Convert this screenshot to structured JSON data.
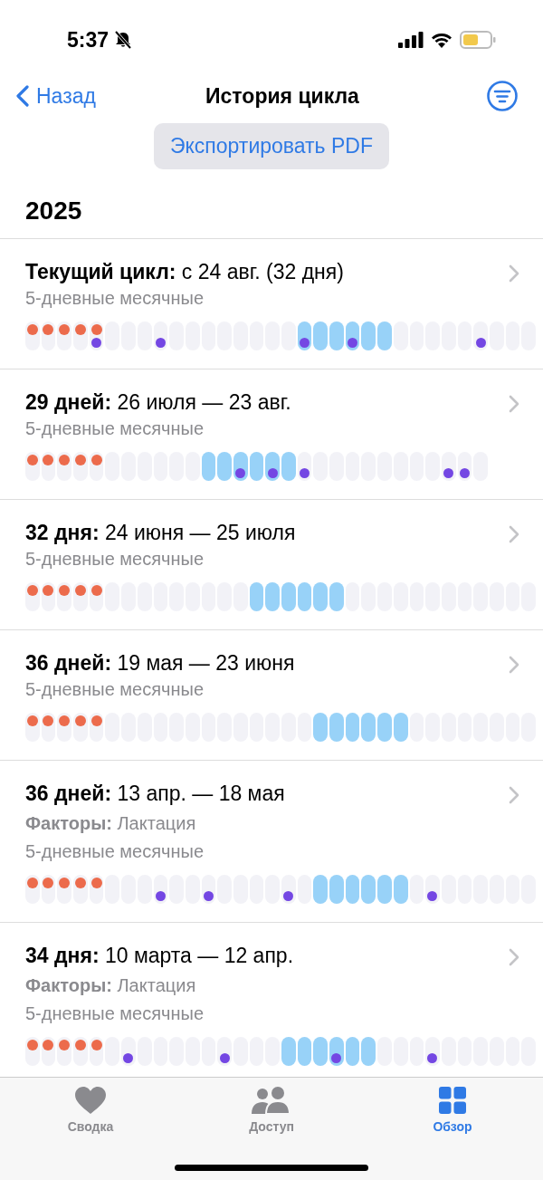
{
  "status_bar": {
    "time": "5:37"
  },
  "nav": {
    "back": "Назад",
    "title": "История цикла"
  },
  "export_button": "Экспортировать PDF",
  "year": "2025",
  "cycles": [
    {
      "title": "**Текущий цикл:** с 24 авг. (32 дня)",
      "subtitle": "5-дневные месячные",
      "days": [
        {
          "period": true,
          "fertile": false,
          "logged": false
        },
        {
          "period": true,
          "fertile": false,
          "logged": false
        },
        {
          "period": true,
          "fertile": false,
          "logged": false
        },
        {
          "period": true,
          "fertile": false,
          "logged": false
        },
        {
          "period": true,
          "fertile": false,
          "logged": true
        },
        {
          "period": false,
          "fertile": false,
          "logged": false
        },
        {
          "period": false,
          "fertile": false,
          "logged": false
        },
        {
          "period": false,
          "fertile": false,
          "logged": false
        },
        {
          "period": false,
          "fertile": false,
          "logged": true
        },
        {
          "period": false,
          "fertile": false,
          "logged": false
        },
        {
          "period": false,
          "fertile": false,
          "logged": false
        },
        {
          "period": false,
          "fertile": false,
          "logged": false
        },
        {
          "period": false,
          "fertile": false,
          "logged": false
        },
        {
          "period": false,
          "fertile": false,
          "logged": false
        },
        {
          "period": false,
          "fertile": false,
          "logged": false
        },
        {
          "period": false,
          "fertile": false,
          "logged": false
        },
        {
          "period": false,
          "fertile": false,
          "logged": false
        },
        {
          "period": false,
          "fertile": true,
          "logged": true
        },
        {
          "period": false,
          "fertile": true,
          "logged": false
        },
        {
          "period": false,
          "fertile": true,
          "logged": false
        },
        {
          "period": false,
          "fertile": true,
          "logged": true
        },
        {
          "period": false,
          "fertile": true,
          "logged": false
        },
        {
          "period": false,
          "fertile": true,
          "logged": false
        },
        {
          "period": false,
          "fertile": false,
          "logged": false
        },
        {
          "period": false,
          "fertile": false,
          "logged": false
        },
        {
          "period": false,
          "fertile": false,
          "logged": false
        },
        {
          "period": false,
          "fertile": false,
          "logged": false
        },
        {
          "period": false,
          "fertile": false,
          "logged": false
        },
        {
          "period": false,
          "fertile": false,
          "logged": true
        },
        {
          "period": false,
          "fertile": false,
          "logged": false
        },
        {
          "period": false,
          "fertile": false,
          "logged": false
        },
        {
          "period": false,
          "fertile": false,
          "logged": false
        }
      ]
    },
    {
      "title": "**29 дней:** 26 июля — 23 авг.",
      "subtitle": "5-дневные месячные",
      "days": [
        {
          "period": true,
          "fertile": false,
          "logged": false
        },
        {
          "period": true,
          "fertile": false,
          "logged": false
        },
        {
          "period": true,
          "fertile": false,
          "logged": false
        },
        {
          "period": true,
          "fertile": false,
          "logged": false
        },
        {
          "period": true,
          "fertile": false,
          "logged": false
        },
        {
          "period": false,
          "fertile": false,
          "logged": false
        },
        {
          "period": false,
          "fertile": false,
          "logged": false
        },
        {
          "period": false,
          "fertile": false,
          "logged": false
        },
        {
          "period": false,
          "fertile": false,
          "logged": false
        },
        {
          "period": false,
          "fertile": false,
          "logged": false
        },
        {
          "period": false,
          "fertile": false,
          "logged": false
        },
        {
          "period": false,
          "fertile": true,
          "logged": false
        },
        {
          "period": false,
          "fertile": true,
          "logged": false
        },
        {
          "period": false,
          "fertile": true,
          "logged": true
        },
        {
          "period": false,
          "fertile": true,
          "logged": false
        },
        {
          "period": false,
          "fertile": true,
          "logged": true
        },
        {
          "period": false,
          "fertile": true,
          "logged": false
        },
        {
          "period": false,
          "fertile": false,
          "logged": true
        },
        {
          "period": false,
          "fertile": false,
          "logged": false
        },
        {
          "period": false,
          "fertile": false,
          "logged": false
        },
        {
          "period": false,
          "fertile": false,
          "logged": false
        },
        {
          "period": false,
          "fertile": false,
          "logged": false
        },
        {
          "period": false,
          "fertile": false,
          "logged": false
        },
        {
          "period": false,
          "fertile": false,
          "logged": false
        },
        {
          "period": false,
          "fertile": false,
          "logged": false
        },
        {
          "period": false,
          "fertile": false,
          "logged": false
        },
        {
          "period": false,
          "fertile": false,
          "logged": true
        },
        {
          "period": false,
          "fertile": false,
          "logged": true
        },
        {
          "period": false,
          "fertile": false,
          "logged": false
        }
      ]
    },
    {
      "title": "**32 дня:** 24 июня — 25 июля",
      "subtitle": "5-дневные месячные",
      "days": [
        {
          "period": true,
          "fertile": false,
          "logged": false
        },
        {
          "period": true,
          "fertile": false,
          "logged": false
        },
        {
          "period": true,
          "fertile": false,
          "logged": false
        },
        {
          "period": true,
          "fertile": false,
          "logged": false
        },
        {
          "period": true,
          "fertile": false,
          "logged": false
        },
        {
          "period": false,
          "fertile": false,
          "logged": false
        },
        {
          "period": false,
          "fertile": false,
          "logged": false
        },
        {
          "period": false,
          "fertile": false,
          "logged": false
        },
        {
          "period": false,
          "fertile": false,
          "logged": false
        },
        {
          "period": false,
          "fertile": false,
          "logged": false
        },
        {
          "period": false,
          "fertile": false,
          "logged": false
        },
        {
          "period": false,
          "fertile": false,
          "logged": false
        },
        {
          "period": false,
          "fertile": false,
          "logged": false
        },
        {
          "period": false,
          "fertile": false,
          "logged": false
        },
        {
          "period": false,
          "fertile": true,
          "logged": false
        },
        {
          "period": false,
          "fertile": true,
          "logged": false
        },
        {
          "period": false,
          "fertile": true,
          "logged": false
        },
        {
          "period": false,
          "fertile": true,
          "logged": false
        },
        {
          "period": false,
          "fertile": true,
          "logged": false
        },
        {
          "period": false,
          "fertile": true,
          "logged": false
        },
        {
          "period": false,
          "fertile": false,
          "logged": false
        },
        {
          "period": false,
          "fertile": false,
          "logged": false
        },
        {
          "period": false,
          "fertile": false,
          "logged": false
        },
        {
          "period": false,
          "fertile": false,
          "logged": false
        },
        {
          "period": false,
          "fertile": false,
          "logged": false
        },
        {
          "period": false,
          "fertile": false,
          "logged": false
        },
        {
          "period": false,
          "fertile": false,
          "logged": false
        },
        {
          "period": false,
          "fertile": false,
          "logged": false
        },
        {
          "period": false,
          "fertile": false,
          "logged": false
        },
        {
          "period": false,
          "fertile": false,
          "logged": false
        },
        {
          "period": false,
          "fertile": false,
          "logged": false
        },
        {
          "period": false,
          "fertile": false,
          "logged": false
        }
      ]
    },
    {
      "title": "**36 дней:** 19 мая — 23 июня",
      "subtitle": "5-дневные месячные",
      "days": [
        {
          "period": true,
          "fertile": false,
          "logged": false
        },
        {
          "period": true,
          "fertile": false,
          "logged": false
        },
        {
          "period": true,
          "fertile": false,
          "logged": false
        },
        {
          "period": true,
          "fertile": false,
          "logged": false
        },
        {
          "period": true,
          "fertile": false,
          "logged": false
        },
        {
          "period": false,
          "fertile": false,
          "logged": false
        },
        {
          "period": false,
          "fertile": false,
          "logged": false
        },
        {
          "period": false,
          "fertile": false,
          "logged": false
        },
        {
          "period": false,
          "fertile": false,
          "logged": false
        },
        {
          "period": false,
          "fertile": false,
          "logged": false
        },
        {
          "period": false,
          "fertile": false,
          "logged": false
        },
        {
          "period": false,
          "fertile": false,
          "logged": false
        },
        {
          "period": false,
          "fertile": false,
          "logged": false
        },
        {
          "period": false,
          "fertile": false,
          "logged": false
        },
        {
          "period": false,
          "fertile": false,
          "logged": false
        },
        {
          "period": false,
          "fertile": false,
          "logged": false
        },
        {
          "period": false,
          "fertile": false,
          "logged": false
        },
        {
          "period": false,
          "fertile": false,
          "logged": false
        },
        {
          "period": false,
          "fertile": true,
          "logged": false
        },
        {
          "period": false,
          "fertile": true,
          "logged": false
        },
        {
          "period": false,
          "fertile": true,
          "logged": false
        },
        {
          "period": false,
          "fertile": true,
          "logged": false
        },
        {
          "period": false,
          "fertile": true,
          "logged": false
        },
        {
          "period": false,
          "fertile": true,
          "logged": false
        },
        {
          "period": false,
          "fertile": false,
          "logged": false
        },
        {
          "period": false,
          "fertile": false,
          "logged": false
        },
        {
          "period": false,
          "fertile": false,
          "logged": false
        },
        {
          "period": false,
          "fertile": false,
          "logged": false
        },
        {
          "period": false,
          "fertile": false,
          "logged": false
        },
        {
          "period": false,
          "fertile": false,
          "logged": false
        },
        {
          "period": false,
          "fertile": false,
          "logged": false
        },
        {
          "period": false,
          "fertile": false,
          "logged": false
        }
      ]
    },
    {
      "title": "**36 дней:** 13 апр. — 18 мая",
      "factors": "**Факторы:** Лактация",
      "subtitle": "5-дневные месячные",
      "days": [
        {
          "period": true,
          "fertile": false,
          "logged": false
        },
        {
          "period": true,
          "fertile": false,
          "logged": false
        },
        {
          "period": true,
          "fertile": false,
          "logged": false
        },
        {
          "period": true,
          "fertile": false,
          "logged": false
        },
        {
          "period": true,
          "fertile": false,
          "logged": false
        },
        {
          "period": false,
          "fertile": false,
          "logged": false
        },
        {
          "period": false,
          "fertile": false,
          "logged": false
        },
        {
          "period": false,
          "fertile": false,
          "logged": false
        },
        {
          "period": false,
          "fertile": false,
          "logged": true
        },
        {
          "period": false,
          "fertile": false,
          "logged": false
        },
        {
          "period": false,
          "fertile": false,
          "logged": false
        },
        {
          "period": false,
          "fertile": false,
          "logged": true
        },
        {
          "period": false,
          "fertile": false,
          "logged": false
        },
        {
          "period": false,
          "fertile": false,
          "logged": false
        },
        {
          "period": false,
          "fertile": false,
          "logged": false
        },
        {
          "period": false,
          "fertile": false,
          "logged": false
        },
        {
          "period": false,
          "fertile": false,
          "logged": true
        },
        {
          "period": false,
          "fertile": false,
          "logged": false
        },
        {
          "period": false,
          "fertile": true,
          "logged": false
        },
        {
          "period": false,
          "fertile": true,
          "logged": false
        },
        {
          "period": false,
          "fertile": true,
          "logged": false
        },
        {
          "period": false,
          "fertile": true,
          "logged": false
        },
        {
          "period": false,
          "fertile": true,
          "logged": false
        },
        {
          "period": false,
          "fertile": true,
          "logged": false
        },
        {
          "period": false,
          "fertile": false,
          "logged": false
        },
        {
          "period": false,
          "fertile": false,
          "logged": true
        },
        {
          "period": false,
          "fertile": false,
          "logged": false
        },
        {
          "period": false,
          "fertile": false,
          "logged": false
        },
        {
          "period": false,
          "fertile": false,
          "logged": false
        },
        {
          "period": false,
          "fertile": false,
          "logged": false
        },
        {
          "period": false,
          "fertile": false,
          "logged": false
        },
        {
          "period": false,
          "fertile": false,
          "logged": false
        }
      ]
    },
    {
      "title": "**34 дня:** 10 марта — 12 апр.",
      "factors": "**Факторы:** Лактация",
      "subtitle": "5-дневные месячные",
      "days": [
        {
          "period": true,
          "fertile": false,
          "logged": false
        },
        {
          "period": true,
          "fertile": false,
          "logged": false
        },
        {
          "period": true,
          "fertile": false,
          "logged": false
        },
        {
          "period": true,
          "fertile": false,
          "logged": false
        },
        {
          "period": true,
          "fertile": false,
          "logged": false
        },
        {
          "period": false,
          "fertile": false,
          "logged": false
        },
        {
          "period": false,
          "fertile": false,
          "logged": true
        },
        {
          "period": false,
          "fertile": false,
          "logged": false
        },
        {
          "period": false,
          "fertile": false,
          "logged": false
        },
        {
          "period": false,
          "fertile": false,
          "logged": false
        },
        {
          "period": false,
          "fertile": false,
          "logged": false
        },
        {
          "period": false,
          "fertile": false,
          "logged": false
        },
        {
          "period": false,
          "fertile": false,
          "logged": true
        },
        {
          "period": false,
          "fertile": false,
          "logged": false
        },
        {
          "period": false,
          "fertile": false,
          "logged": false
        },
        {
          "period": false,
          "fertile": false,
          "logged": false
        },
        {
          "period": false,
          "fertile": true,
          "logged": false
        },
        {
          "period": false,
          "fertile": true,
          "logged": false
        },
        {
          "period": false,
          "fertile": true,
          "logged": false
        },
        {
          "period": false,
          "fertile": true,
          "logged": true
        },
        {
          "period": false,
          "fertile": true,
          "logged": false
        },
        {
          "period": false,
          "fertile": true,
          "logged": false
        },
        {
          "period": false,
          "fertile": false,
          "logged": false
        },
        {
          "period": false,
          "fertile": false,
          "logged": false
        },
        {
          "period": false,
          "fertile": false,
          "logged": false
        },
        {
          "period": false,
          "fertile": false,
          "logged": true
        },
        {
          "period": false,
          "fertile": false,
          "logged": false
        },
        {
          "period": false,
          "fertile": false,
          "logged": false
        },
        {
          "period": false,
          "fertile": false,
          "logged": false
        },
        {
          "period": false,
          "fertile": false,
          "logged": false
        },
        {
          "period": false,
          "fertile": false,
          "logged": false
        },
        {
          "period": false,
          "fertile": false,
          "logged": false
        }
      ]
    }
  ],
  "tabs": [
    {
      "label": "Сводка",
      "kind": "heart",
      "selected": false
    },
    {
      "label": "Доступ",
      "kind": "people",
      "selected": false
    },
    {
      "label": "Обзор",
      "kind": "grid",
      "selected": true
    }
  ]
}
